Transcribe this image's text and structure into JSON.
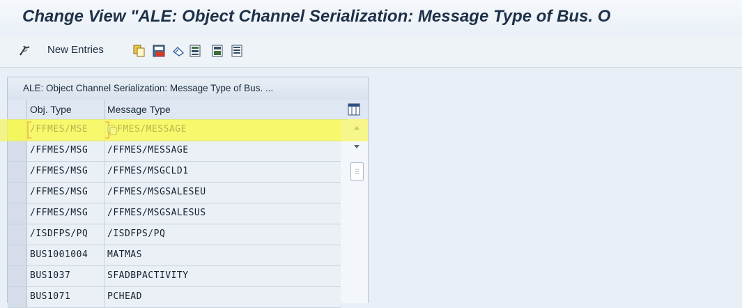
{
  "title": "Change View \"ALE: Object Channel Serialization: Message Type of Bus. O",
  "toolbar": {
    "new_entries_label": "New Entries",
    "icons": [
      "display-change-icon",
      "copy-icon",
      "delete-icon",
      "undo-icon",
      "select-all-icon",
      "select-block-icon",
      "deselect-all-icon"
    ]
  },
  "table": {
    "title": "ALE: Object Channel Serialization: Message Type of Bus. ...",
    "columns": [
      "Obj. Type",
      "Message Type"
    ],
    "rows": [
      {
        "obj_type": "/FFMES/MSE",
        "message_type": "FMES/MESSAGE"
      },
      {
        "obj_type": "/FFMES/MSG",
        "message_type": "/FFMES/MESSAGE"
      },
      {
        "obj_type": "/FFMES/MSG",
        "message_type": "/FFMES/MSGCLD1"
      },
      {
        "obj_type": "/FFMES/MSG",
        "message_type": "/FFMES/MSGSALESEU"
      },
      {
        "obj_type": "/FFMES/MSG",
        "message_type": "/FFMES/MSGSALESUS"
      },
      {
        "obj_type": "/ISDFPS/PQ",
        "message_type": "/ISDFPS/PQ"
      },
      {
        "obj_type": "BUS1001004",
        "message_type": "MATMAS"
      },
      {
        "obj_type": "BUS1037",
        "message_type": "SFADBPACTIVITY"
      },
      {
        "obj_type": "BUS1071",
        "message_type": "PCHEAD"
      }
    ],
    "selected_row": 0
  },
  "colors": {
    "accent_yellow": "#f5f55a",
    "header_text": "#1f3147"
  }
}
